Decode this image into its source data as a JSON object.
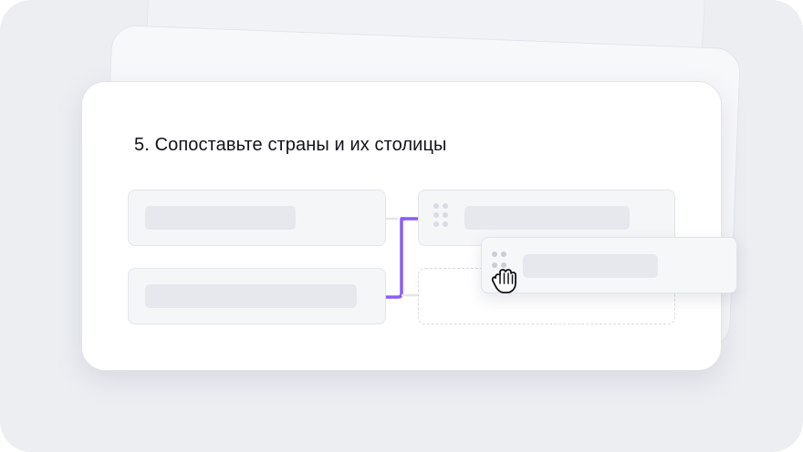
{
  "question": {
    "number": "5.",
    "title": "Сопоставьте страны и их столицы"
  },
  "matching": {
    "left_items": [
      {
        "text": ""
      },
      {
        "text": ""
      }
    ],
    "right_items": [
      {
        "text": ""
      }
    ],
    "dragging_item": {
      "text": ""
    },
    "connector_color": "#8b5cf6"
  },
  "icons": {
    "drag_handle": "drag-handle-icon",
    "cursor": "grab-hand-cursor-icon"
  },
  "colors": {
    "background": "#eceef2",
    "card": "#ffffff",
    "accent": "#8b5cf6"
  }
}
